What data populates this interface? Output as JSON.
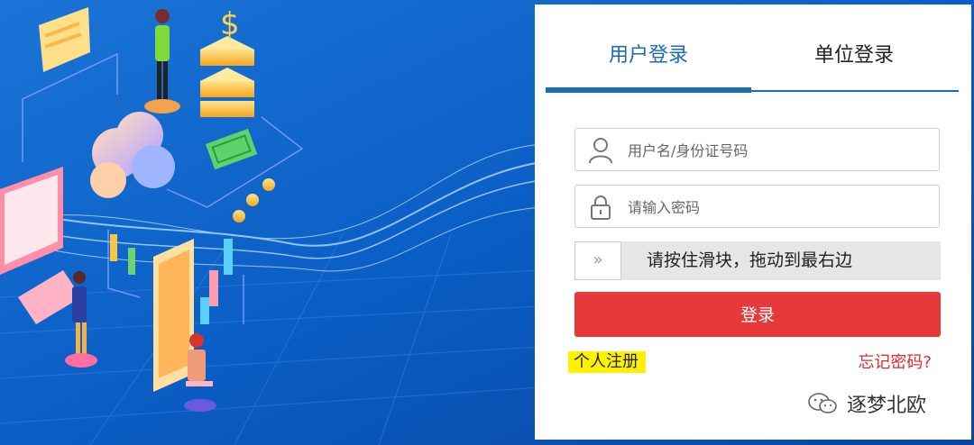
{
  "tabs": [
    {
      "label": "用户登录",
      "active": true
    },
    {
      "label": "单位登录",
      "active": false
    }
  ],
  "form": {
    "username_placeholder": "用户名/身份证号码",
    "password_placeholder": "请输入密码",
    "slider_text": "请按住滑块，拖动到最右边",
    "slider_handle_glyph": "»",
    "login_label": "登录"
  },
  "links": {
    "register_label": "个人注册",
    "forgot_label": "忘记密码?"
  },
  "watermark": {
    "label": "逐梦北欧"
  },
  "colors": {
    "accent_blue": "#1d6bb8",
    "login_red": "#e8393a",
    "forgot_red": "#e02b2b",
    "highlight_yellow": "#fff200"
  },
  "icons": [
    "user-icon",
    "lock-icon",
    "double-chevron-right-icon",
    "wechat-icon"
  ]
}
